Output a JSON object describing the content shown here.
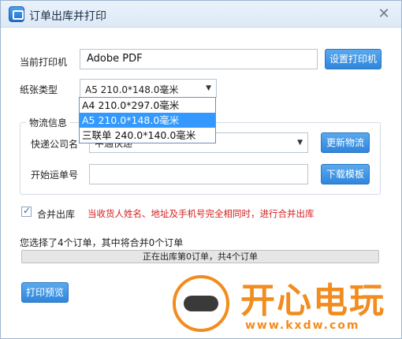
{
  "window": {
    "title": "订单出库并打印"
  },
  "printer": {
    "label": "当前打印机",
    "value": "Adobe PDF",
    "setup_button": "设置打印机"
  },
  "paper": {
    "label": "纸张类型",
    "selected": "A5  210.0*148.0毫米",
    "options": [
      "A4  210.0*297.0毫米",
      "A5  210.0*148.0毫米",
      "三联单  240.0*140.0毫米"
    ],
    "selected_index": 1
  },
  "logistics": {
    "group_title": "物流信息",
    "company_label": "快递公司名",
    "company_value": "中通快递",
    "update_button": "更新物流",
    "waybill_label": "开始运单号",
    "waybill_value": "",
    "download_button": "下载模板"
  },
  "merge": {
    "label": "合并出库",
    "checked": true,
    "warning": "当收货人姓名、地址及手机号完全相同时，进行合并出库"
  },
  "summary": {
    "text": "您选择了4个订单，其中将合并0个订单"
  },
  "progress": {
    "text": "正在出库第0订单，共4个订单",
    "value": 0
  },
  "preview_button": "打印预览",
  "watermark": {
    "brand": "开心电玩",
    "url": "www.kxdw.com"
  },
  "colors": {
    "accent": "#2f86dc",
    "warning": "#d42020",
    "watermark": "#f28c1e"
  }
}
